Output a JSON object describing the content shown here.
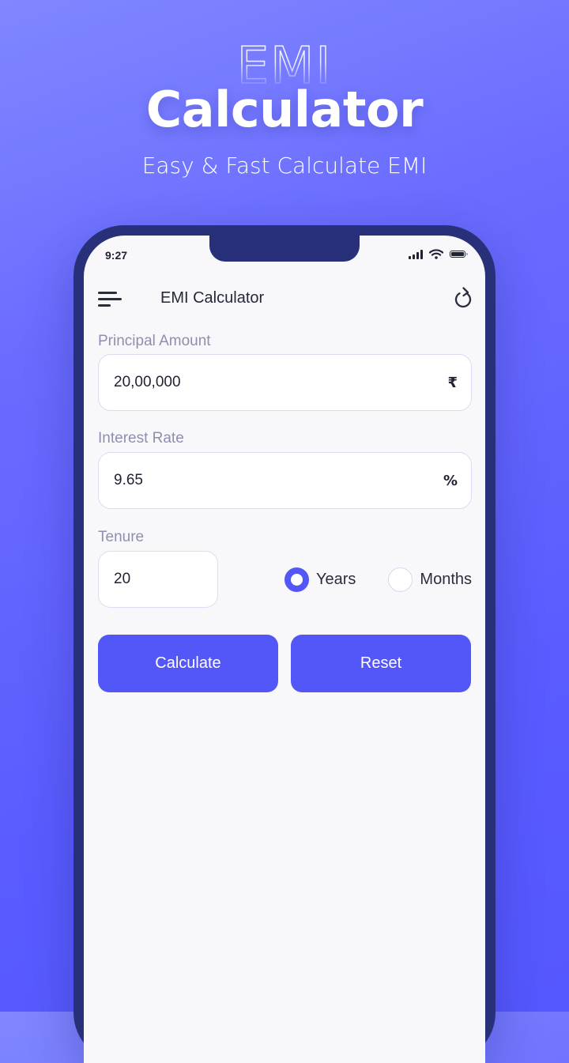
{
  "promo": {
    "outline_title": "EMI",
    "title": "Calculator",
    "subtitle": "Easy & Fast Calculate EMI"
  },
  "status_bar": {
    "time": "9:27",
    "icons": [
      "signal-icon",
      "wifi-icon",
      "battery-icon"
    ]
  },
  "app_bar": {
    "title": "EMI Calculator",
    "left_icon": "menu-icon",
    "right_icon": "refresh-icon"
  },
  "form": {
    "principal": {
      "label": "Principal Amount",
      "value": "20,00,000",
      "suffix": "₹"
    },
    "interest": {
      "label": "Interest Rate",
      "value": "9.65",
      "suffix": "%"
    },
    "tenure": {
      "label": "Tenure",
      "value": "20",
      "options": [
        {
          "label": "Years",
          "selected": true
        },
        {
          "label": "Months",
          "selected": false
        }
      ]
    }
  },
  "actions": {
    "calculate_label": "Calculate",
    "reset_label": "Reset"
  },
  "colors": {
    "accent": "#5457f8",
    "frame": "#29307a",
    "label": "#8e8fae",
    "field_border": "#dcdbf4",
    "screen_bg": "#f8f8fb"
  }
}
